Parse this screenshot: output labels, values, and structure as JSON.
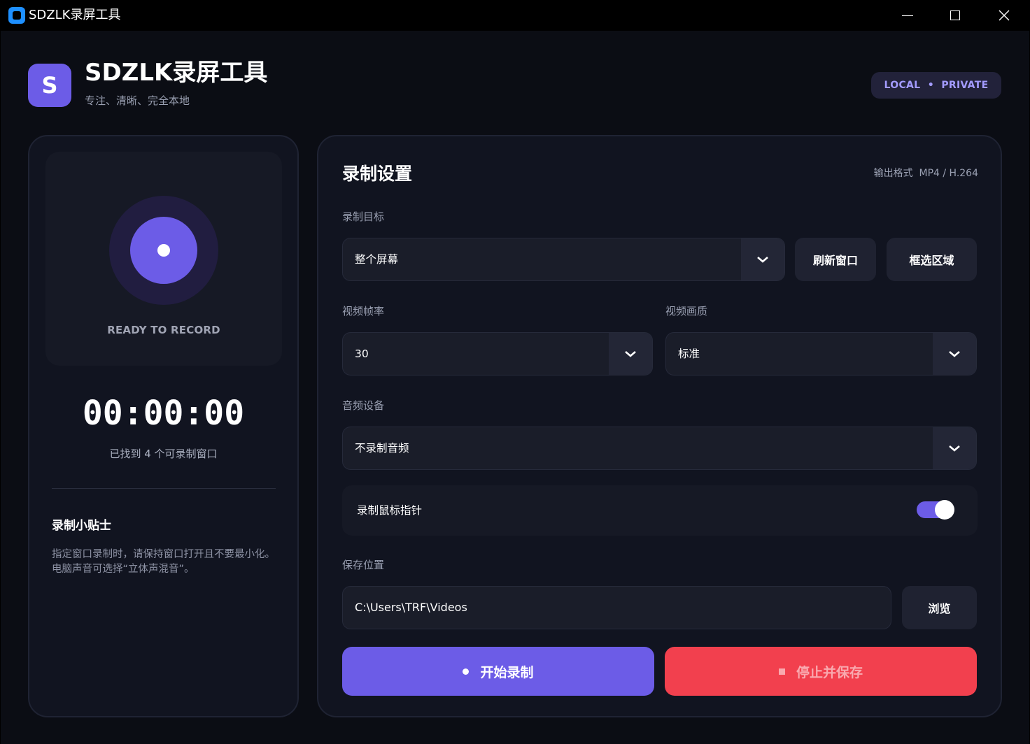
{
  "window": {
    "title": "SDZLK录屏工具"
  },
  "header": {
    "logo_letter": "S",
    "title": "SDZLK录屏工具",
    "subtitle": "专注、清晰、完全本地",
    "badge": "LOCAL  •  PRIVATE"
  },
  "status_panel": {
    "ready_text": "READY TO RECORD",
    "timer": "00:00:00",
    "found_text": "已找到 4 个可录制窗口",
    "tips_title": "录制小贴士",
    "tips_text": "指定窗口录制时，请保持窗口打开且不要最小化。电脑声音可选择“立体声混音”。"
  },
  "settings": {
    "title": "录制设置",
    "output_format": "输出格式  MP4 / H.264",
    "target_label": "录制目标",
    "target_value": "整个屏幕",
    "refresh_button": "刷新窗口",
    "select_region_button": "框选区域",
    "fps_label": "视频帧率",
    "fps_value": "30",
    "quality_label": "视频画质",
    "quality_value": "标准",
    "audio_label": "音频设备",
    "audio_value": "不录制音频",
    "cursor_label": "录制鼠标指针",
    "cursor_enabled": true,
    "save_label": "保存位置",
    "save_path": "C:\\Users\\TRF\\Videos",
    "browse_button": "浏览",
    "start_button": "开始录制",
    "stop_button": "停止并保存"
  },
  "colors": {
    "accent": "#6c5ce7",
    "danger": "#f2404e",
    "background": "#0b0d14",
    "panel": "#111420"
  }
}
